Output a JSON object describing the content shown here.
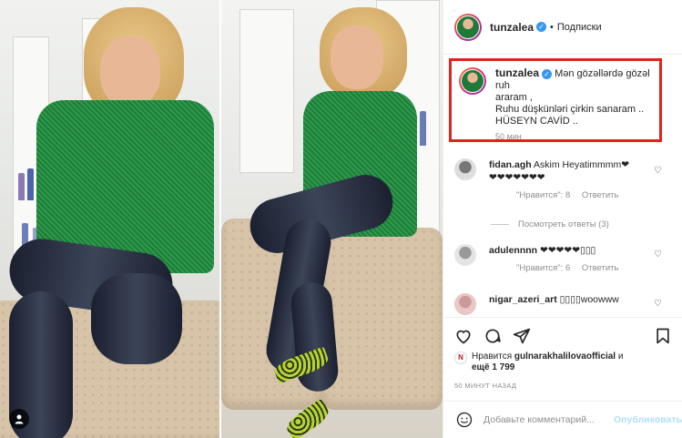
{
  "post": {
    "author": "tunzalea",
    "follow_label": "Подписки",
    "caption_lines": [
      "Mən gözəllərdə gözəl ruh",
      "araram ,",
      "Ruhu düşkünləri çirkin sanaram ..",
      "HÜSEYN CAVİD .."
    ],
    "caption_time": "50 мин"
  },
  "comments": [
    {
      "user": "fidan.agh",
      "text": "Askim Heyatimmmm❤",
      "text2": "❤❤❤❤❤❤❤",
      "likes_label": "\"Нравится\": 8",
      "reply_label": "Ответить"
    },
    {
      "user": "adulennnn",
      "text": "❤❤❤❤❤▯▯▯",
      "likes_label": "\"Нравится\": 6",
      "reply_label": "Ответить"
    },
    {
      "user": "nigar_azeri_art",
      "text": "▯▯▯▯woowww"
    }
  ],
  "view_replies": "Посмотреть ответы (3)",
  "likes": {
    "liked_by_prefix": "Нравится",
    "liked_by_user": "gulnarakhalilovaofficial",
    "liked_by_suffix": "и",
    "others": "ещё 1 799"
  },
  "posted_ago": "50 МИНУТ НАЗАД",
  "composer": {
    "placeholder": "Добавьте комментарий...",
    "publish_label": "Опубликовать"
  },
  "colors": {
    "highlight_border": "#e0231d",
    "verified": "#3897f0",
    "publish_disabled": "#b2dffc"
  },
  "icons": [
    "verified-badge-icon",
    "heart-icon",
    "comment-icon",
    "share-icon",
    "bookmark-icon",
    "emoji-icon",
    "profile-tag-icon"
  ]
}
